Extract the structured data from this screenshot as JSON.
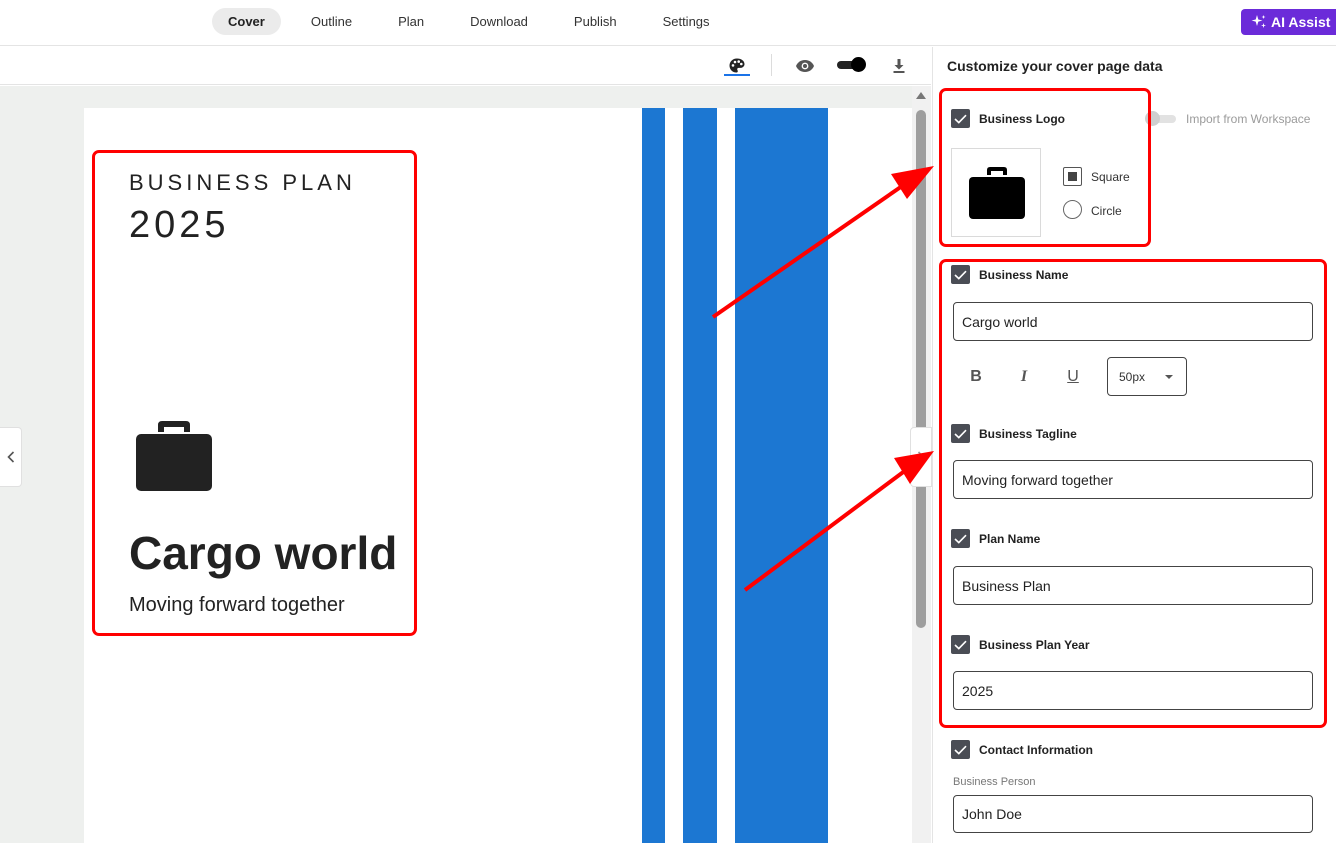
{
  "nav": {
    "tabs": [
      {
        "label": "Cover",
        "active": true
      },
      {
        "label": "Outline",
        "active": false
      },
      {
        "label": "Plan",
        "active": false
      },
      {
        "label": "Download",
        "active": false
      },
      {
        "label": "Publish",
        "active": false
      },
      {
        "label": "Settings",
        "active": false
      }
    ],
    "ai_assist_label": "AI Assist"
  },
  "preview_toolbar": {
    "icons": [
      "palette-icon",
      "eye-icon",
      "toggle-switch",
      "download-icon"
    ]
  },
  "cover": {
    "title": "BUSINESS PLAN",
    "year": "2025",
    "business_name": "Cargo world",
    "tagline": "Moving forward together",
    "logo_icon": "briefcase-icon",
    "stripe_color": "#1c77d2"
  },
  "panel": {
    "title": "Customize your cover page data",
    "business_logo": {
      "label": "Business Logo",
      "checked": true,
      "import_label": "Import from Workspace",
      "shape_options": [
        "Square",
        "Circle"
      ],
      "selected_shape": "Square"
    },
    "business_name": {
      "label": "Business Name",
      "checked": true,
      "value": "Cargo world",
      "format_buttons": [
        "B",
        "I",
        "U"
      ],
      "font_size": "50px"
    },
    "business_tagline": {
      "label": "Business Tagline",
      "checked": true,
      "value": "Moving forward together"
    },
    "plan_name": {
      "label": "Plan Name",
      "checked": true,
      "value": "Business Plan"
    },
    "plan_year": {
      "label": "Business Plan Year",
      "checked": true,
      "value": "2025"
    },
    "contact": {
      "label": "Contact Information",
      "checked": true,
      "person_label": "Business Person",
      "person_value": "John Doe"
    }
  },
  "colors": {
    "accent": "#6b2bd9",
    "annotation": "#ff0000",
    "stripe": "#1c77d2"
  }
}
